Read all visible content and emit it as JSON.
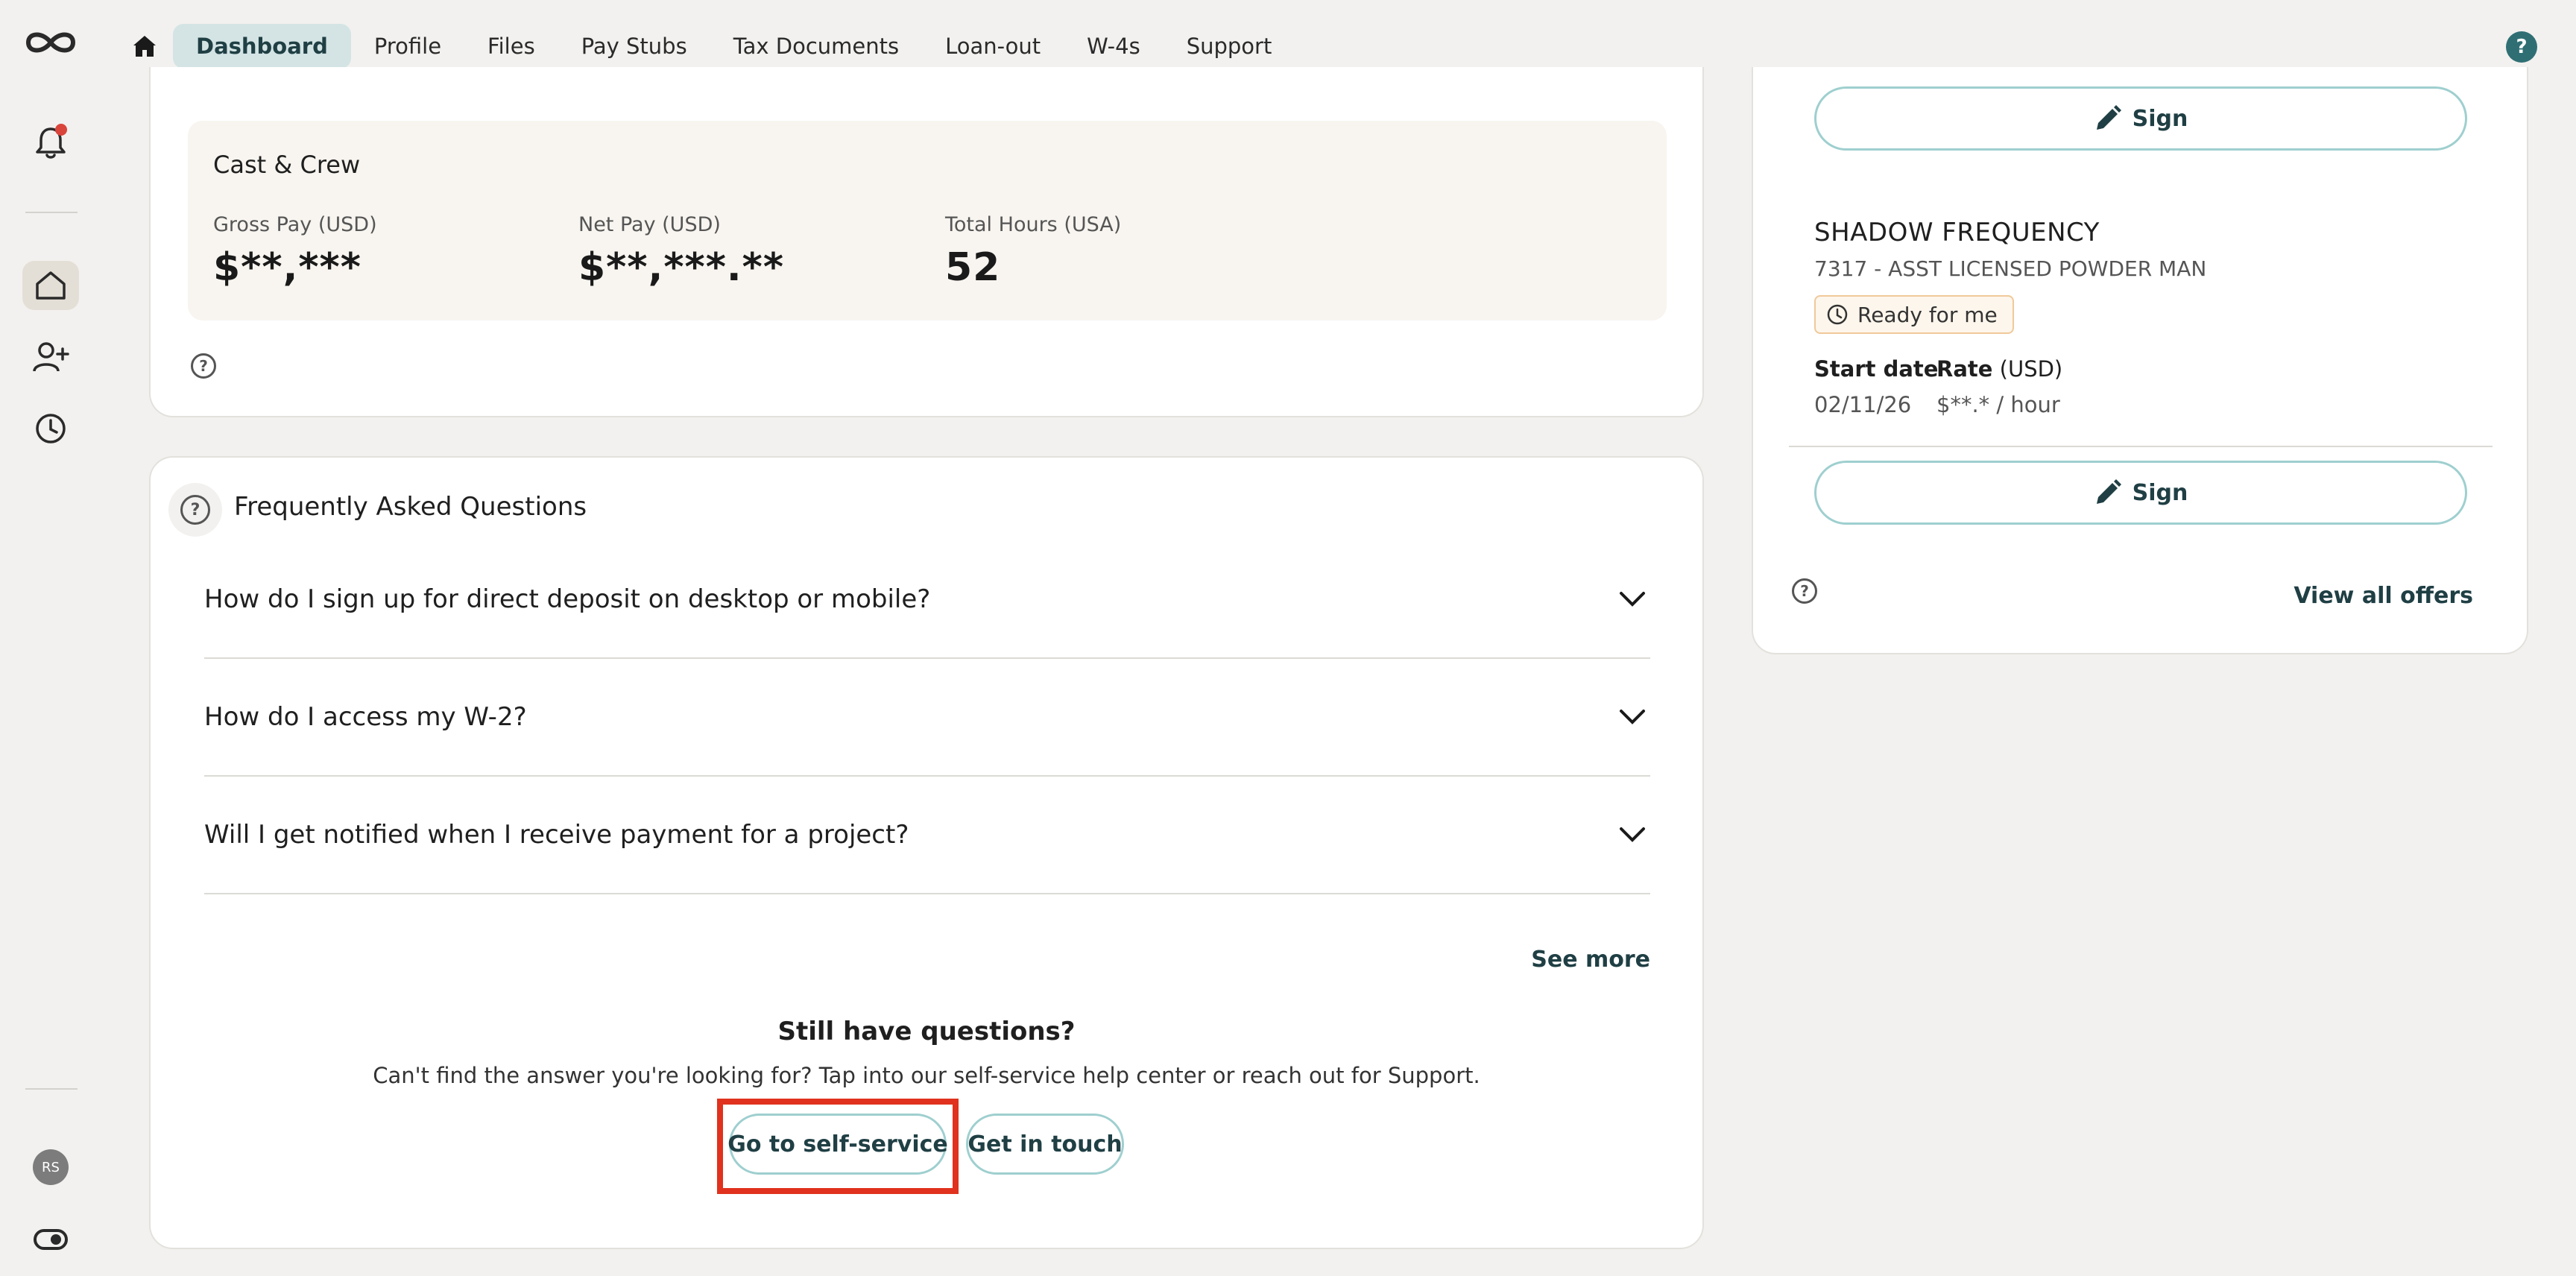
{
  "nav": {
    "tabs": [
      {
        "label": "Dashboard",
        "active": true
      },
      {
        "label": "Profile"
      },
      {
        "label": "Files"
      },
      {
        "label": "Pay Stubs"
      },
      {
        "label": "Tax Documents"
      },
      {
        "label": "Loan-out"
      },
      {
        "label": "W-4s"
      },
      {
        "label": "Support"
      }
    ],
    "help_icon": "?"
  },
  "sidebar": {
    "avatar_initials": "RS",
    "icons": [
      "logo-icon",
      "bell-icon",
      "home-icon",
      "add-user-icon",
      "clock-icon",
      "theme-toggle-icon"
    ]
  },
  "summary": {
    "company": "Cast & Crew",
    "stats": [
      {
        "label": "Gross Pay (USD)",
        "value": "$**,***"
      },
      {
        "label": "Net Pay (USD)",
        "value": "$**,***.**"
      },
      {
        "label": "Total Hours (USA)",
        "value": "52"
      }
    ]
  },
  "faq": {
    "title": "Frequently Asked Questions",
    "questions": [
      "How do I sign up for direct deposit on desktop or mobile?",
      "How do I access my W-2?",
      "Will I get notified when I receive payment for a project?"
    ],
    "see_more": "See more",
    "still_title": "Still have questions?",
    "still_sub": "Can't find the answer you're looking for? Tap into our self-service help center or reach out for Support.",
    "self_service_label": "Go to self-service",
    "get_in_touch_label": "Get in touch"
  },
  "offers": {
    "sign_label": "Sign",
    "offer": {
      "title": "SHADOW FREQUENCY",
      "subtitle": "7317 - ASST LICENSED POWDER MAN",
      "status": "Ready for me",
      "start_label": "Start date",
      "start_value": "02/11/26",
      "rate_label": "Rate",
      "rate_unit": "(USD)",
      "rate_value": "$**.* / hour"
    },
    "view_all": "View all offers"
  },
  "colors": {
    "accent": "#2f6f74",
    "tab_active_bg": "#d4e4e4",
    "button_border": "#9fcfcf",
    "highlight": "#e0321e",
    "notification_dot": "#d9443b"
  }
}
